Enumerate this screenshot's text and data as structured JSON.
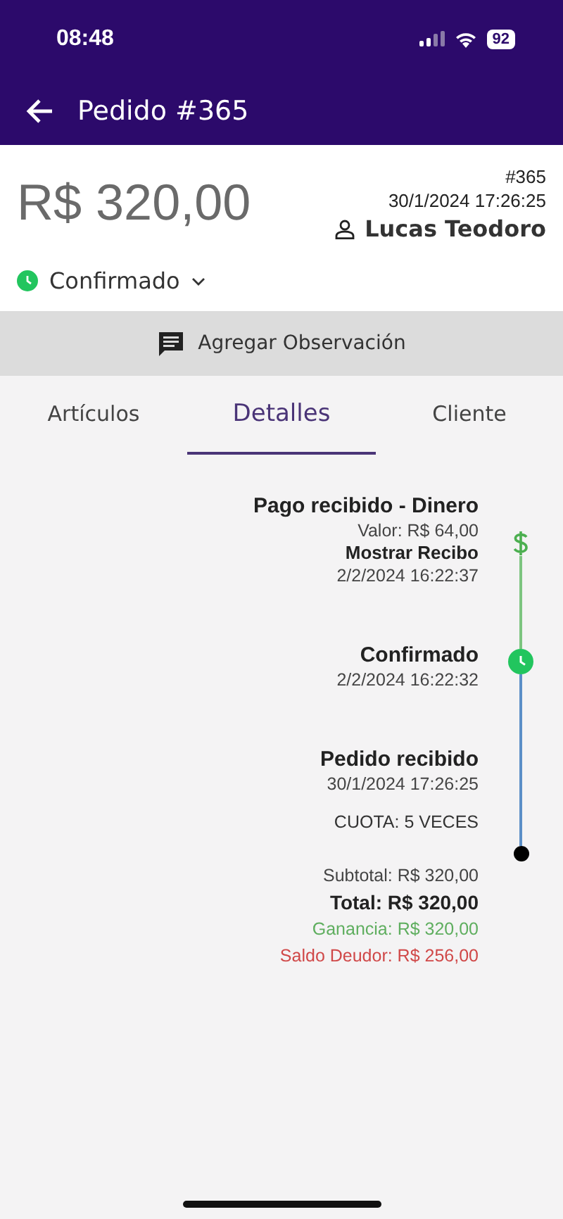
{
  "status_bar": {
    "time": "08:48",
    "battery": "92"
  },
  "header": {
    "title": "Pedido #365"
  },
  "summary": {
    "amount": "R$ 320,00",
    "order_number": "#365",
    "date": "30/1/2024 17:26:25",
    "customer": "Lucas Teodoro",
    "status": {
      "label": "Confirmado",
      "color": "#22c55e"
    }
  },
  "observation_button": {
    "label": "Agregar Observación"
  },
  "tabs": [
    {
      "label": "Artículos",
      "selected": false
    },
    {
      "label": "Detalles",
      "selected": true
    },
    {
      "label": "Cliente",
      "selected": false
    }
  ],
  "timeline": [
    {
      "kind": "payment",
      "title": "Pago recibido - Dinero",
      "lines": [
        "Valor: R$ 64,00"
      ],
      "link": "Mostrar Recibo",
      "date": "2/2/2024 16:22:37",
      "color": "#4caf50"
    },
    {
      "kind": "status",
      "title": "Confirmado",
      "date": "2/2/2024 16:22:32",
      "color": "#22c55e"
    },
    {
      "kind": "order",
      "title": "Pedido recibido",
      "date": "30/1/2024 17:26:25",
      "note": "CUOTA: 5 VECES",
      "color": "#000000"
    }
  ],
  "totals": {
    "subtotal": "Subtotal: R$ 320,00",
    "total": "Total: R$ 320,00",
    "profit": "Ganancia: R$ 320,00",
    "balance": "Saldo Deudor: R$ 256,00"
  }
}
